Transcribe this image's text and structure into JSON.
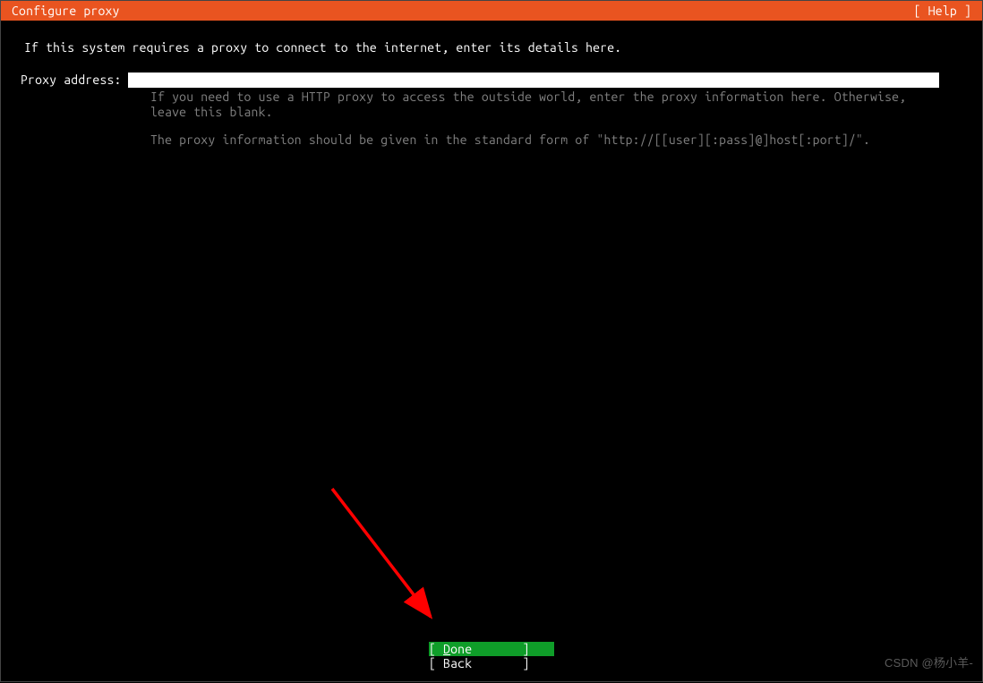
{
  "header": {
    "title": "Configure proxy",
    "help": "[ Help ]"
  },
  "intro": "If this system requires a proxy to connect to the internet, enter its details here.",
  "form": {
    "proxy_label": "Proxy address:",
    "proxy_value": "",
    "help1": "If you need to use a HTTP proxy to access the outside world, enter the proxy information here. Otherwise, leave this blank.",
    "help2": "The proxy information should be given in the standard form of \"http://[[user][:pass]@]host[:port]/\"."
  },
  "footer": {
    "done_open": "[ ",
    "done_letter": "D",
    "done_rest": "one       ",
    "done_close": "]",
    "back": "[ Back       ]"
  },
  "watermark": "CSDN @杨小羊-"
}
